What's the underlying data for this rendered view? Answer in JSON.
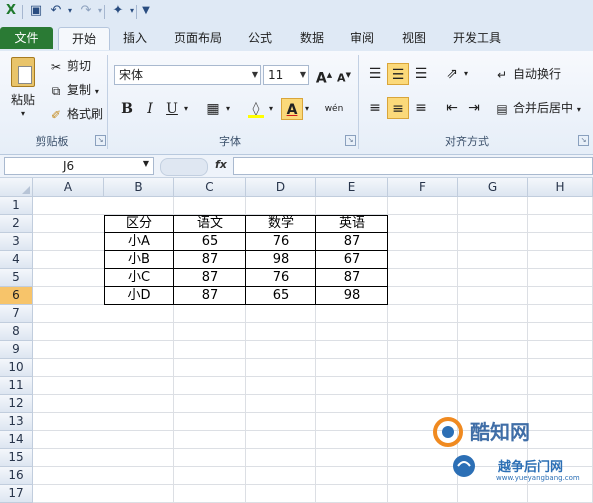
{
  "ribbon_tabs": [
    "文件",
    "开始",
    "插入",
    "页面布局",
    "公式",
    "数据",
    "审阅",
    "视图",
    "开发工具"
  ],
  "clipboard": {
    "paste": "粘贴",
    "cut": "剪切",
    "copy": "复制",
    "format_painter": "格式刷",
    "group_label": "剪贴板"
  },
  "font": {
    "name": "宋体",
    "size": "11",
    "group_label": "字体",
    "bold": "B",
    "italic": "I",
    "underline": "U",
    "grow": "A",
    "shrink": "A",
    "font_color": "A",
    "phonetic": "wén"
  },
  "alignment": {
    "wrap_text": "自动换行",
    "merge_center": "合并后居中",
    "group_label": "对齐方式"
  },
  "formula_bar": {
    "name_box": "J6",
    "fx": "fx",
    "formula": ""
  },
  "columns": [
    "A",
    "B",
    "C",
    "D",
    "E",
    "F",
    "G",
    "H"
  ],
  "rows": [
    "1",
    "2",
    "3",
    "4",
    "5",
    "6",
    "7",
    "8",
    "9",
    "10",
    "11",
    "12",
    "13",
    "14",
    "15",
    "16",
    "17"
  ],
  "selected_row": "6",
  "table": {
    "headers": [
      "区分",
      "语文",
      "数学",
      "英语"
    ],
    "rows": [
      [
        "小A",
        "65",
        "76",
        "87"
      ],
      [
        "小B",
        "87",
        "98",
        "67"
      ],
      [
        "小C",
        "87",
        "76",
        "87"
      ],
      [
        "小D",
        "87",
        "65",
        "98"
      ]
    ]
  },
  "watermark": {
    "brand": "酷知网",
    "site_name": "越争后门网",
    "url": "www.yueyangbang.com"
  },
  "colors": {
    "file_tab": "#2a7a34",
    "selected_row_header": "#f7c46a",
    "active_button": "#fbd97a"
  }
}
